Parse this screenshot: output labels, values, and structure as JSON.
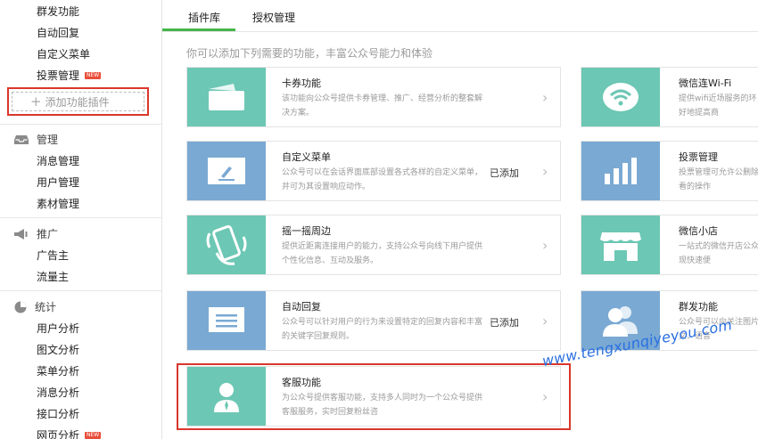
{
  "sidebar": {
    "function_items": [
      {
        "label": "群发功能",
        "new": false
      },
      {
        "label": "自动回复",
        "new": false
      },
      {
        "label": "自定义菜单",
        "new": false
      },
      {
        "label": "投票管理",
        "new": true
      }
    ],
    "add_plugin_label": "添加功能插件",
    "new_badge_text": "NEW",
    "manage": {
      "title": "管理",
      "items": [
        "消息管理",
        "用户管理",
        "素材管理"
      ]
    },
    "promote": {
      "title": "推广",
      "items": [
        "广告主",
        "流量主"
      ]
    },
    "stats": {
      "title": "统计",
      "items": [
        {
          "label": "用户分析",
          "new": false
        },
        {
          "label": "图文分析",
          "new": false
        },
        {
          "label": "菜单分析",
          "new": false
        },
        {
          "label": "消息分析",
          "new": false
        },
        {
          "label": "接口分析",
          "new": false
        },
        {
          "label": "网页分析",
          "new": true
        }
      ]
    }
  },
  "tabs": [
    {
      "label": "插件库",
      "active": true
    },
    {
      "label": "授权管理",
      "active": false
    }
  ],
  "hint": "你可以添加下列需要的功能，丰富公众号能力和体验",
  "plugins_left": [
    {
      "title": "卡券功能",
      "desc": "该功能向公众号提供卡券管理、推广、经营分析的整套解决方案。",
      "added": "",
      "icon": "card-icon",
      "color": "#6cc7b4"
    },
    {
      "title": "自定义菜单",
      "desc": "公众号可以在会话界面底部设置各式各样的自定义菜单，并可为其设置响应动作。",
      "added": "已添加",
      "icon": "edit-menu-icon",
      "color": "#7aa9d3"
    },
    {
      "title": "摇一摇周边",
      "desc": "提供近距离连接用户的能力，支持公众号向线下用户提供个性化信息、互动及服务。",
      "added": "",
      "icon": "shake-phone-icon",
      "color": "#6cc7b4"
    },
    {
      "title": "自动回复",
      "desc": "公众号可以针对用户的行为来设置特定的回复内容和丰富的关键字回复规则。",
      "added": "已添加",
      "icon": "message-icon",
      "color": "#7aa9d3"
    },
    {
      "title": "客服功能",
      "desc": "为公众号提供客服功能，支持多人同时为一个公众号提供客服服务，实时回复粉丝咨",
      "added": "",
      "icon": "customer-service-icon",
      "color": "#6cc7b4"
    }
  ],
  "plugins_right": [
    {
      "title": "微信连Wi-Fi",
      "desc": "提供wifi近场服务的环，更好地提高商",
      "icon": "wifi-icon",
      "color": "#6cc7b4"
    },
    {
      "title": "投票管理",
      "desc": "投票管理可允许公删除和查看的操作",
      "icon": "bar-chart-icon",
      "color": "#7aa9d3"
    },
    {
      "title": "微信小店",
      "desc": "一站式的微信开店公众号实现快速便",
      "icon": "shop-icon",
      "color": "#6cc7b4"
    },
    {
      "title": "群发功能",
      "desc": "公众号可以向关注图片、图文、语音",
      "icon": "users-icon",
      "color": "#7aa9d3"
    }
  ],
  "watermark": "www.tengxunqiyeyou.com",
  "colors": {
    "accent": "#44b549",
    "highlight": "#d9372d",
    "teal": "#6cc7b4",
    "blue": "#7aa9d3"
  }
}
